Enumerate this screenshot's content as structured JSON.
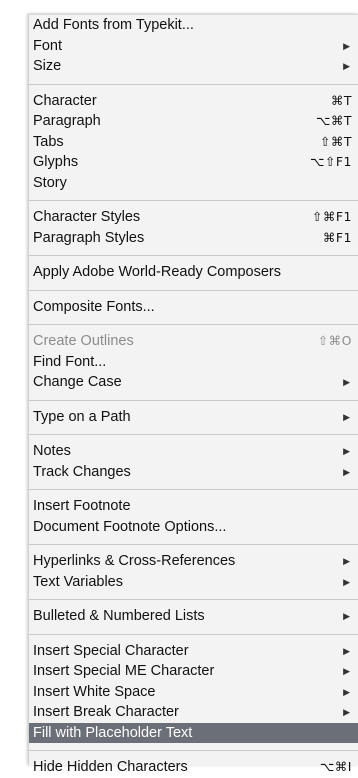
{
  "menu": {
    "groups": [
      {
        "items": [
          {
            "label": "Add Fonts from Typekit...",
            "shortcut": "",
            "submenu": false
          },
          {
            "label": "Font",
            "shortcut": "",
            "submenu": true
          },
          {
            "label": "Size",
            "shortcut": "",
            "submenu": true
          }
        ]
      },
      {
        "items": [
          {
            "label": "Character",
            "shortcut": "⌘T",
            "submenu": false
          },
          {
            "label": "Paragraph",
            "shortcut": "⌥⌘T",
            "submenu": false
          },
          {
            "label": "Tabs",
            "shortcut": "⇧⌘T",
            "submenu": false
          },
          {
            "label": "Glyphs",
            "shortcut": "⌥⇧F1",
            "submenu": false
          },
          {
            "label": "Story",
            "shortcut": "",
            "submenu": false
          }
        ]
      },
      {
        "items": [
          {
            "label": "Character Styles",
            "shortcut": "⇧⌘F1",
            "submenu": false
          },
          {
            "label": "Paragraph Styles",
            "shortcut": "⌘F1",
            "submenu": false
          }
        ]
      },
      {
        "items": [
          {
            "label": "Apply Adobe World-Ready Composers",
            "shortcut": "",
            "submenu": false
          }
        ]
      },
      {
        "items": [
          {
            "label": "Composite Fonts...",
            "shortcut": "",
            "submenu": false
          }
        ]
      },
      {
        "items": [
          {
            "label": "Create Outlines",
            "shortcut": "⇧⌘O",
            "submenu": false,
            "disabled": true
          },
          {
            "label": "Find Font...",
            "shortcut": "",
            "submenu": false
          },
          {
            "label": "Change Case",
            "shortcut": "",
            "submenu": true
          }
        ]
      },
      {
        "items": [
          {
            "label": "Type on a Path",
            "shortcut": "",
            "submenu": true
          }
        ]
      },
      {
        "items": [
          {
            "label": "Notes",
            "shortcut": "",
            "submenu": true
          },
          {
            "label": "Track Changes",
            "shortcut": "",
            "submenu": true
          }
        ]
      },
      {
        "items": [
          {
            "label": "Insert Footnote",
            "shortcut": "",
            "submenu": false
          },
          {
            "label": "Document Footnote Options...",
            "shortcut": "",
            "submenu": false
          }
        ]
      },
      {
        "items": [
          {
            "label": "Hyperlinks & Cross-References",
            "shortcut": "",
            "submenu": true
          },
          {
            "label": "Text Variables",
            "shortcut": "",
            "submenu": true
          }
        ]
      },
      {
        "items": [
          {
            "label": "Bulleted & Numbered Lists",
            "shortcut": "",
            "submenu": true
          }
        ]
      },
      {
        "items": [
          {
            "label": "Insert Special Character",
            "shortcut": "",
            "submenu": true
          },
          {
            "label": "Insert Special ME Character",
            "shortcut": "",
            "submenu": true
          },
          {
            "label": "Insert White Space",
            "shortcut": "",
            "submenu": true
          },
          {
            "label": "Insert Break Character",
            "shortcut": "",
            "submenu": true
          },
          {
            "label": "Fill with Placeholder Text",
            "shortcut": "",
            "submenu": false,
            "highlighted": true
          }
        ]
      },
      {
        "items": [
          {
            "label": "Hide Hidden Characters",
            "shortcut": "⌥⌘I",
            "submenu": false
          }
        ]
      }
    ],
    "submenu_arrow": "▶",
    "colors": {
      "menu_background": "#f3f3f3",
      "highlight_background": "#6b6f78",
      "disabled_text": "#8c8c8c",
      "separator": "#c9c9c9"
    }
  }
}
